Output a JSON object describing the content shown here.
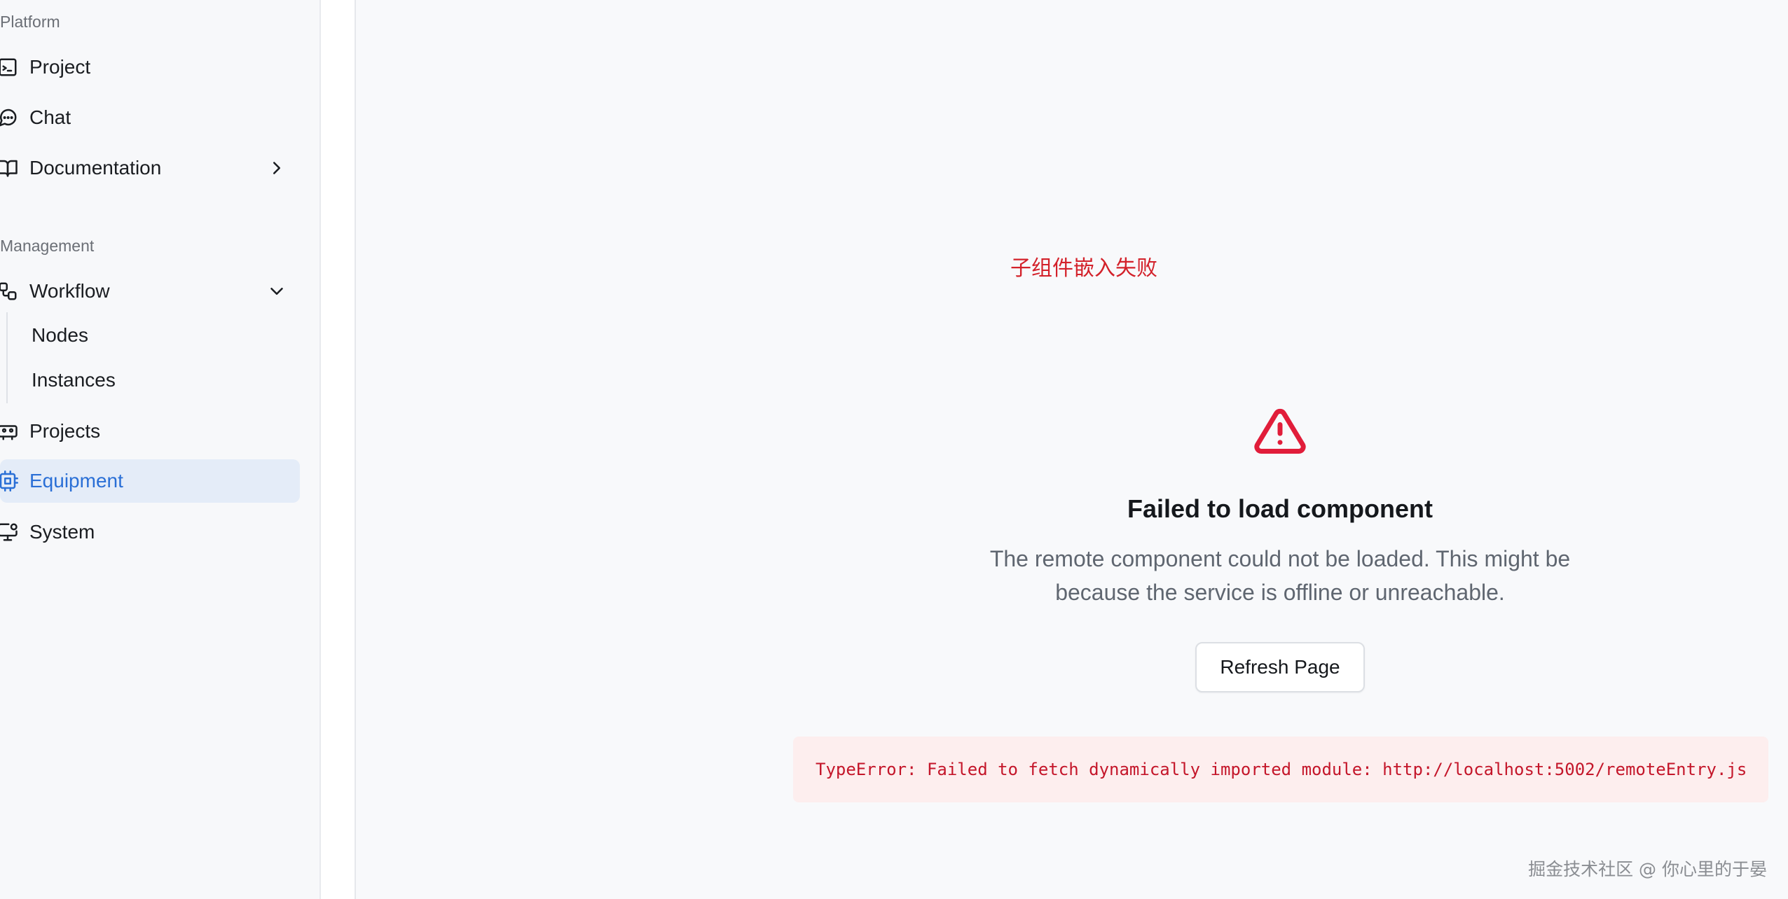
{
  "sidebar": {
    "platform_label": "Platform",
    "management_label": "Management",
    "platform_items": [
      {
        "label": "Project",
        "icon": "terminal-square-icon"
      },
      {
        "label": "Chat",
        "icon": "message-circle-icon"
      },
      {
        "label": "Documentation",
        "icon": "book-open-icon"
      }
    ],
    "management_items": [
      {
        "label": "Workflow",
        "icon": "workflow-icon"
      },
      {
        "label": "Projects",
        "icon": "projects-icon"
      },
      {
        "label": "Equipment",
        "icon": "cpu-icon"
      },
      {
        "label": "System",
        "icon": "monitor-cog-icon"
      }
    ],
    "workflow_children": [
      "Nodes",
      "Instances"
    ],
    "active_item": "Equipment"
  },
  "main": {
    "embed_status": "子组件嵌入失败",
    "error_title": "Failed to load component",
    "error_description": "The remote component could not be loaded. This might be because the service is offline or unreachable.",
    "refresh_button": "Refresh Page",
    "error_message": "TypeError: Failed to fetch dynamically imported module: http://localhost:5002/remoteEntry.js"
  },
  "watermark": "掘金技术社区 @ 你心里的于晏",
  "colors": {
    "active_bg": "#e4ecf8",
    "active_text": "#2a6fd6",
    "error_red": "#d3212a",
    "error_box_bg": "#fdeeee"
  }
}
